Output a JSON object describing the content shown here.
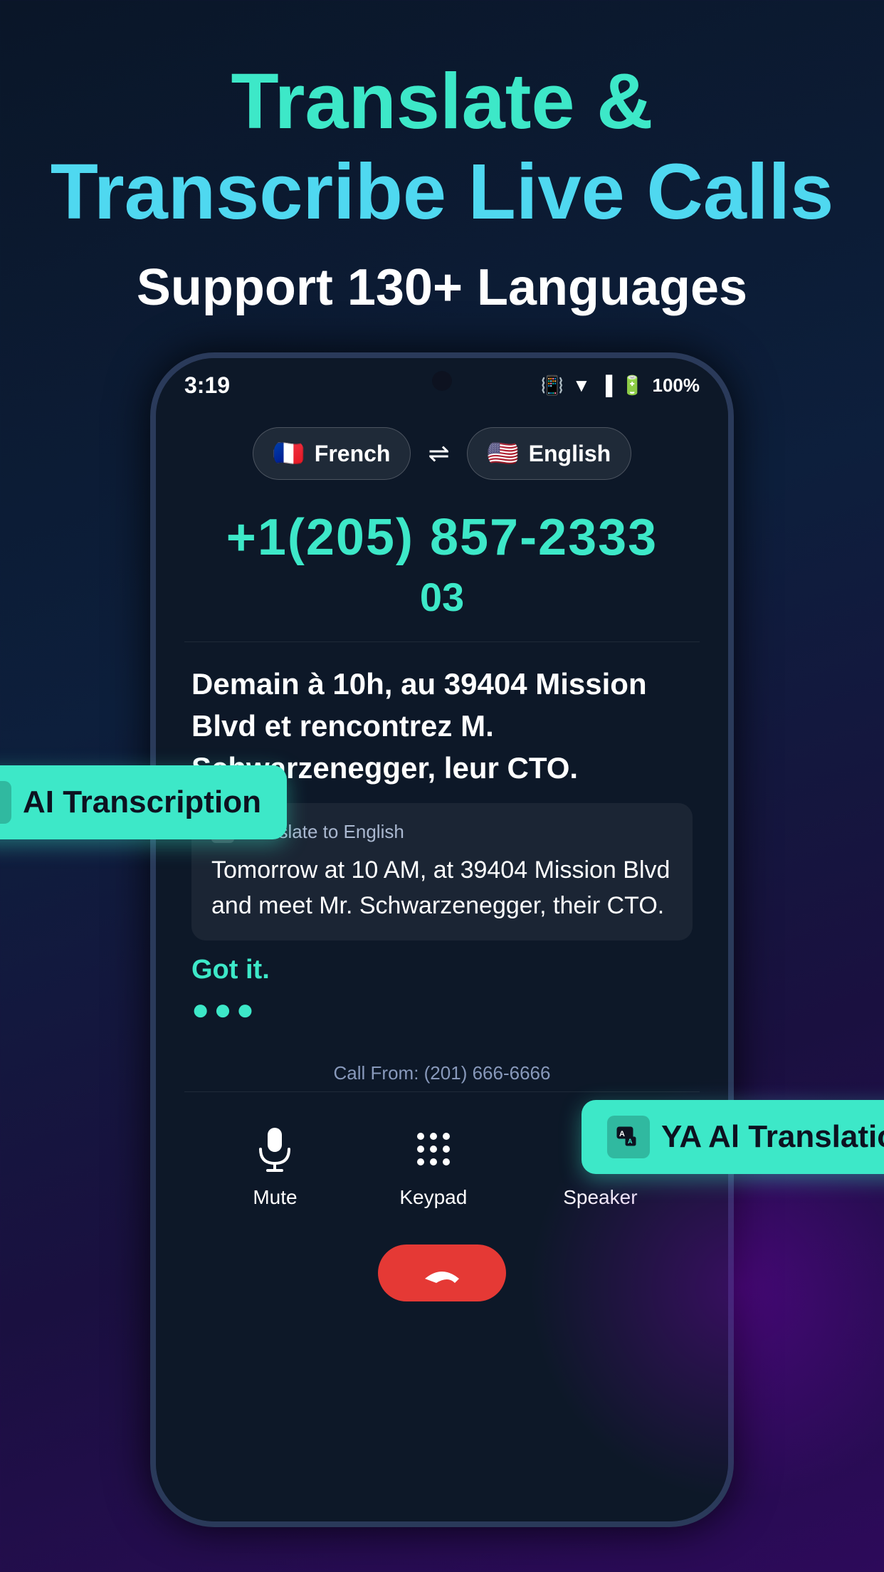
{
  "hero": {
    "line1a": "Translate &",
    "line2": "Transcribe Live Calls",
    "subtitle": "Support 130+ Languages"
  },
  "phone": {
    "status_bar": {
      "time": "3:19",
      "battery": "100%"
    },
    "languages": {
      "from": "French",
      "to": "English",
      "swap_icon": "⇌"
    },
    "phone_number": "+1(205) 857-2333",
    "phone_number_partial": "03",
    "french_text": "Demain à 10h, au 39404 Mission Blvd et rencontrez M. Schwarzenegger, leur CTO.",
    "translate_label": "Translate to English",
    "english_text": "Tomorrow at 10 AM, at 39404 Mission Blvd and meet Mr. Schwarzenegger, their CTO.",
    "got_it": "Got it.",
    "dots": "●●●",
    "call_from": "Call From: (201) 666-6666",
    "controls": {
      "mute": "Mute",
      "keypad": "Keypad",
      "speaker": "Speaker"
    }
  },
  "badges": {
    "transcription": "AI Transcription",
    "translation": "YA Al Translation"
  },
  "colors": {
    "teal": "#3de8c8",
    "blue_light": "#4fd8f0",
    "end_call": "#e53935"
  }
}
